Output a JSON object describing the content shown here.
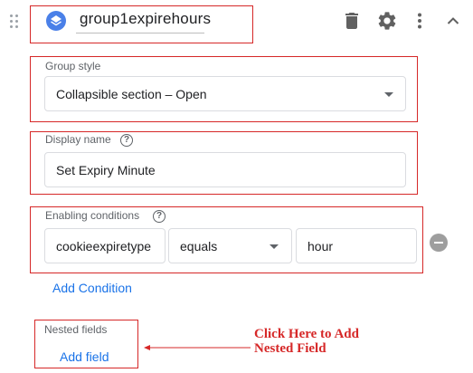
{
  "header": {
    "group_name": "group1expirehours",
    "icons": [
      "drag-handle-icon",
      "layers-icon",
      "delete-icon",
      "settings-icon",
      "more-vert-icon",
      "chevron-up-icon"
    ]
  },
  "group_style": {
    "label": "Group style",
    "value": "Collapsible section – Open"
  },
  "display_name": {
    "label": "Display name",
    "value": "Set Expiry Minute"
  },
  "enabling_conditions": {
    "label": "Enabling conditions",
    "variable": "cookieexpiretype",
    "operator": "equals",
    "value": "hour",
    "add_condition_label": "Add Condition"
  },
  "nested_fields": {
    "label": "Nested fields",
    "add_field_label": "Add field"
  },
  "annotation": {
    "line1": "Click Here to Add",
    "line2": "Nested Field"
  },
  "colors": {
    "accent": "#1a73e8",
    "annotation_red": "#d62828",
    "icon_gray": "#616161",
    "group_icon_blue": "#4a80e8"
  }
}
